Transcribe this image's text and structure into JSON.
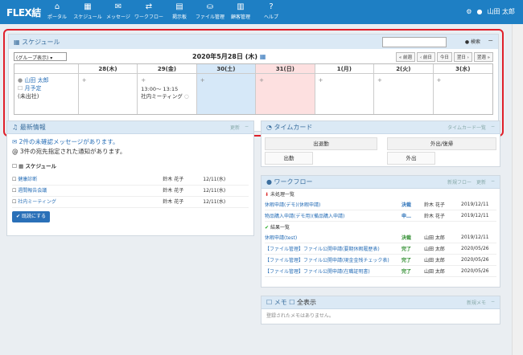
{
  "app": {
    "logo": "FLEX結"
  },
  "nav": [
    {
      "icon": "⌂",
      "label": "ポータル"
    },
    {
      "icon": "▦",
      "label": "スケジュール"
    },
    {
      "icon": "✉",
      "label": "メッセージ"
    },
    {
      "icon": "⇄",
      "label": "ワークフロー"
    },
    {
      "icon": "▤",
      "label": "掲示板"
    },
    {
      "icon": "⛀",
      "label": "ファイル管理"
    },
    {
      "icon": "▥",
      "label": "顧客管理"
    },
    {
      "icon": "?",
      "label": "ヘルプ"
    }
  ],
  "user": {
    "name": "山田 太郎"
  },
  "schedule": {
    "title": "スケジュール",
    "search_label": "検索",
    "group_select": "(グループ表示)",
    "date_title": "2020年5月28日 (木)",
    "nav_buttons": [
      "« 前週",
      "‹ 前日",
      "今日",
      "翌日 ›",
      "翌週 »"
    ],
    "days": [
      "28(木)",
      "29(金)",
      "30(土)",
      "31(日)",
      "1(月)",
      "2(火)",
      "3(水)"
    ],
    "person": {
      "name": "山田 太郎",
      "plan": "月予定",
      "status": "(未出社)"
    },
    "event": {
      "time": "13:00～ 13:15",
      "title": "社内ミーティング"
    }
  },
  "info": {
    "title": "最新情報",
    "refresh": "更新",
    "unread": "2件の未確認メッセージがあります。",
    "notice": "3件の宛先指定された通知があります。",
    "section": "スケジュール",
    "items": [
      {
        "title": "健康診断",
        "user": "鈴木 花子",
        "date": "12/11(水)"
      },
      {
        "title": "週間報告会議",
        "user": "鈴木 花子",
        "date": "12/11(水)"
      },
      {
        "title": "社内ミーティング",
        "user": "鈴木 花子",
        "date": "12/11(水)"
      }
    ],
    "read_button": "既読にする"
  },
  "timecard": {
    "title": "タイムカード",
    "list_link": "タイムカード一覧",
    "buttons": [
      "出退勤",
      "外出/復帰",
      "出勤",
      "外出"
    ]
  },
  "workflow": {
    "title": "ワークフロー",
    "new_label": "新規フロー",
    "refresh": "更新",
    "pending_label": "未処理一覧",
    "done_label": "結果一覧",
    "pending": [
      {
        "title": "休暇申請(デモ)(休暇申請)",
        "status": "決裁",
        "user": "鈴木 花子",
        "date": "2019/12/11"
      },
      {
        "title": "物品購入申請(デモ用)(備品購入申請)",
        "status": "申…",
        "user": "鈴木 花子",
        "date": "2019/12/11"
      }
    ],
    "done": [
      {
        "title": "休暇申請(test)",
        "status": "決裁",
        "user": "山田 太郎",
        "date": "2019/12/11"
      },
      {
        "title": "【ファイル管理】ファイル公開申請(要期休暇履歴表)",
        "status": "完了",
        "user": "山田 太郎",
        "date": "2020/05/26"
      },
      {
        "title": "【ファイル管理】ファイル公開申請(現金金残チェック表)",
        "status": "完了",
        "user": "山田 太郎",
        "date": "2020/05/26"
      },
      {
        "title": "【ファイル管理】ファイル公開申請(在職証明書)",
        "status": "完了",
        "user": "山田 太郎",
        "date": "2020/05/26"
      }
    ]
  },
  "memo": {
    "title": "メモ",
    "show_all": "全表示",
    "new_label": "新規メモ",
    "empty": "登録されたメモはありません。"
  },
  "colors": {
    "topbar": "#1e7fc4",
    "highlight": "#e0202a"
  }
}
